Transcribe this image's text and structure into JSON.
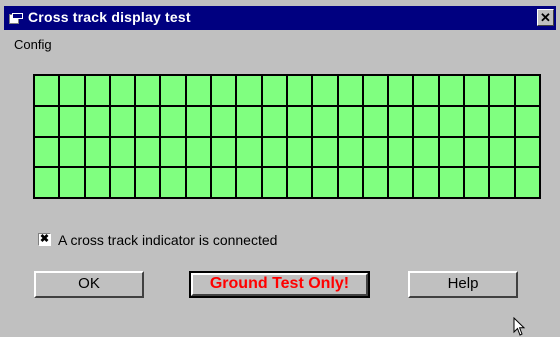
{
  "window": {
    "title": "Cross track display test",
    "close_glyph": "✕"
  },
  "menu": {
    "items": [
      {
        "label": "Config"
      }
    ]
  },
  "display_grid": {
    "rows": 4,
    "columns": 20,
    "cell_color": "#80ff80"
  },
  "checkbox": {
    "label": "A cross track indicator is connected",
    "checked": true,
    "mark": "✖"
  },
  "buttons": {
    "ok": "OK",
    "ground_test": "Ground Test Only!",
    "help": "Help"
  },
  "colors": {
    "title_bar": "#000080",
    "warning_text": "#ff0000",
    "face": "#c0c0c0"
  }
}
